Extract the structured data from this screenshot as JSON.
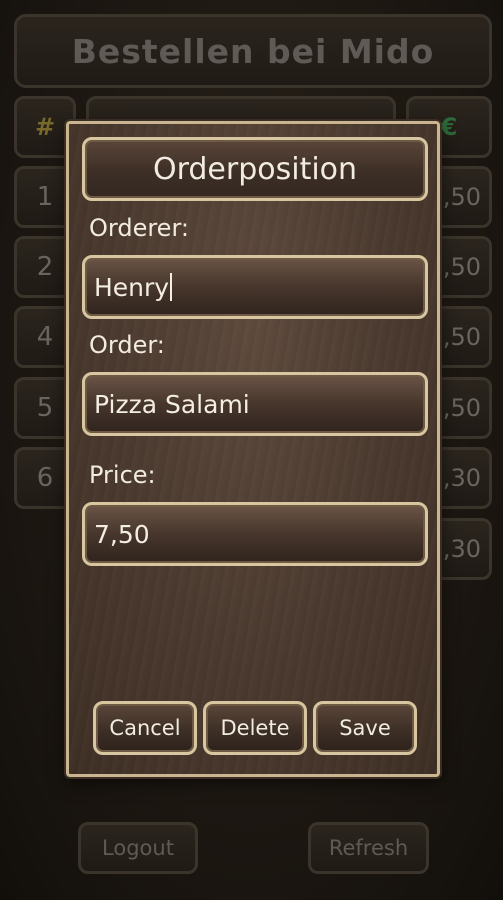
{
  "background": {
    "title": "Bestellen bei Mido",
    "header": {
      "hash": "#",
      "price": "€"
    },
    "rows": [
      {
        "num": "1",
        "price": "3,50"
      },
      {
        "num": "2",
        "price": "4,50"
      },
      {
        "num": "4",
        "price": "7,50"
      },
      {
        "num": "5",
        "price": "7,50"
      },
      {
        "num": "6",
        "price": "4,30"
      }
    ],
    "total": "3,30",
    "logout_label": "Logout",
    "refresh_label": "Refresh"
  },
  "dialog": {
    "title": "Orderposition",
    "orderer_label": "Orderer:",
    "orderer_value": "Henry",
    "order_label": "Order:",
    "order_value": "Pizza Salami",
    "price_label": "Price:",
    "price_value": "7,50",
    "cancel_label": "Cancel",
    "delete_label": "Delete",
    "save_label": "Save"
  }
}
